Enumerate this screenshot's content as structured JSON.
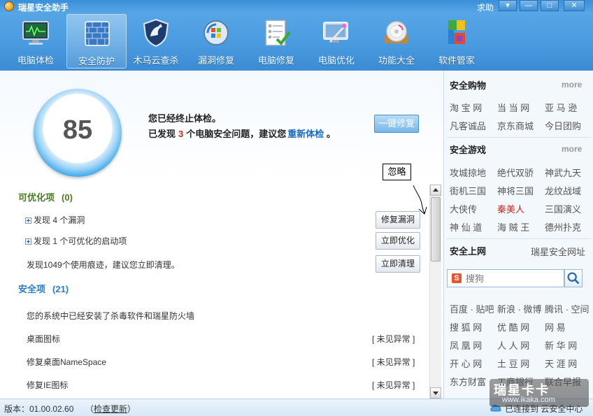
{
  "app": {
    "title": "瑞星安全助手",
    "help": "求助"
  },
  "window_controls": {
    "menu": "▾",
    "minimize": "—",
    "maximize": "□",
    "close": "✕"
  },
  "toolbar": {
    "items": [
      {
        "label": "电脑体检",
        "icon": "monitor-icon",
        "active": false
      },
      {
        "label": "安全防护",
        "icon": "firewall-icon",
        "active": true
      },
      {
        "label": "木马云查杀",
        "icon": "shield-icon",
        "active": false
      },
      {
        "label": "漏洞修复",
        "icon": "windows-globe-icon",
        "active": false
      },
      {
        "label": "电脑修复",
        "icon": "checklist-icon",
        "active": false
      },
      {
        "label": "电脑优化",
        "icon": "optimize-wand-icon",
        "active": false
      },
      {
        "label": "功能大全",
        "icon": "disc-icon",
        "active": false
      },
      {
        "label": "软件管家",
        "icon": "software-blocks-icon",
        "active": false
      }
    ]
  },
  "score": {
    "value": "85"
  },
  "check": {
    "line1": "您已经终止体检。",
    "line2_prefix": "已发现",
    "issue_count": "3",
    "line2_middle": "个电脑安全问题，建议您",
    "recheck_link": "重新体检",
    "line2_suffix": "。",
    "onekey_fix": "一键修复"
  },
  "annotation": {
    "ignore": "忽略"
  },
  "optimizable": {
    "title": "可优化项",
    "count": "(0)",
    "rows": [
      {
        "text": "发现 4 个漏洞",
        "button": "修复漏洞"
      },
      {
        "text": "发现 1 个可优化的启动项",
        "button": "立即优化"
      },
      {
        "text": "发现1049个使用痕迹，建议您立即清理。",
        "button": "立即清理"
      }
    ]
  },
  "safe": {
    "title": "安全项",
    "count": "(21)",
    "rows": [
      {
        "text": "您的系统中已经安装了杀毒软件和瑞星防火墙",
        "status": ""
      },
      {
        "text": "桌面图标",
        "status": "[ 未见异常 ]"
      },
      {
        "text": "修复桌面NameSpace",
        "status": "[ 未见异常 ]"
      },
      {
        "text": "修复IE图标",
        "status": "[ 未见异常 ]"
      }
    ]
  },
  "sidebar": {
    "shopping": {
      "title": "安全购物",
      "more": "more",
      "links": [
        "淘 宝 网",
        "当 当 网",
        "亚 马 逊",
        "凡客诚品",
        "京东商城",
        "今日团购"
      ]
    },
    "games": {
      "title": "安全游戏",
      "more": "more",
      "links": [
        "攻城掠地",
        "绝代双骄",
        "神武九天",
        "街机三国",
        "神将三国",
        "龙纹战域",
        "大侠传",
        "秦美人",
        "三国演义",
        "神 仙 道",
        "海 贼 王",
        "德州扑克"
      ]
    },
    "web": {
      "title": "安全上网",
      "site_link": "瑞星安全网址"
    },
    "search": {
      "placeholder": "搜狗",
      "logo": "S"
    },
    "sites": [
      "百度 · 贴吧",
      "新浪 · 微博",
      "腾讯 · 空间",
      "搜 狐 网",
      "优 酷 网",
      "网 易",
      "凤 凰 网",
      "人 人 网",
      "新 华 网",
      "开 心 网",
      "土 豆 网",
      "天 涯 网",
      "东方财富",
      "工商银行",
      "联合早报"
    ]
  },
  "status": {
    "version": "版本：01.00.02.60",
    "check_update_open": "（",
    "check_update": "检查更新",
    "check_update_close": "）",
    "cloud": "已连接到 云安全中心"
  },
  "watermark": {
    "title": "瑞星卡卡",
    "url": "www.ikaka.com"
  }
}
